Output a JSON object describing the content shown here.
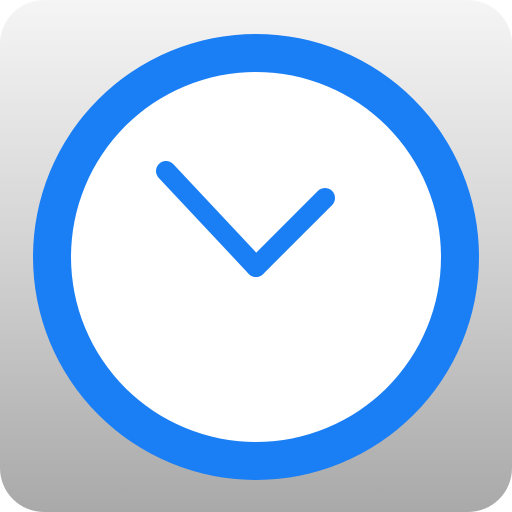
{
  "app_icon": {
    "name": "clock-app-icon",
    "icon": "clock-icon",
    "colors": {
      "ring": "#1a7ef5",
      "face": "#ffffff",
      "hands": "#1a7ef5",
      "background_top": "#f5f5f5",
      "background_bottom": "#a9a9a9"
    },
    "clock": {
      "hour_hand_angle_deg": -45,
      "minute_hand_angle_deg": 45
    }
  }
}
